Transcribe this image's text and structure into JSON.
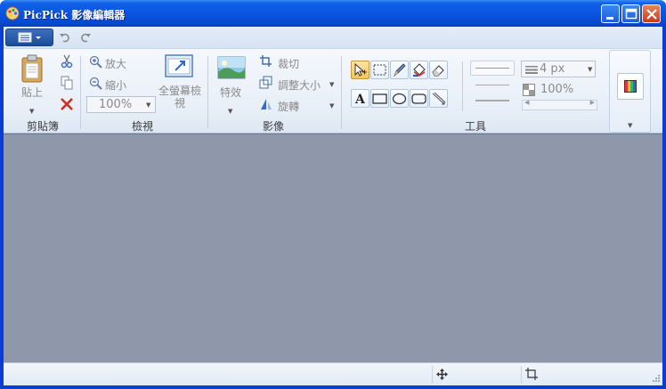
{
  "window": {
    "title": "PicPick 影像編輯器",
    "buttons": [
      "minimize",
      "maximize",
      "close"
    ]
  },
  "quick_access": {
    "items": [
      {
        "name": "app-menu",
        "icon": "menu-icon"
      },
      {
        "name": "undo",
        "icon": "undo-icon"
      },
      {
        "name": "redo",
        "icon": "redo-icon"
      }
    ]
  },
  "ribbon": {
    "clipboard": {
      "label": "剪貼簿",
      "paste": "貼上",
      "cut_icon": "scissors-icon",
      "copy_icon": "copy-icon",
      "delete_icon": "delete-x-icon"
    },
    "view": {
      "label": "檢視",
      "zoom_in": "放大",
      "zoom_out": "縮小",
      "zoom_value": "100%",
      "fullscreen_line1": "全螢幕檢",
      "fullscreen_line2": "視"
    },
    "image": {
      "label": "影像",
      "effects": "特效",
      "crop": "裁切",
      "resize": "調整大小",
      "rotate": "旋轉"
    },
    "tools": {
      "label": "工具",
      "line_width": "4 px",
      "opacity": "100%",
      "tool_icons": [
        "select-arrow-icon",
        "marquee-select-icon",
        "pen-icon",
        "fill-bucket-icon",
        "eraser-icon",
        "text-icon",
        "rectangle-icon",
        "ellipse-icon",
        "rounded-rectangle-icon",
        "line-arrows-icon"
      ]
    },
    "color_icon": "color-palette-icon"
  },
  "status": {
    "move_icon": "move-cross-icon",
    "size_icon": "resize-box-icon",
    "grip_icon": "size-grip-icon"
  },
  "colors": {
    "title_blue": "#0a55e0",
    "ribbon_bg": "#e8eff8",
    "canvas_bg": "#8f98aa",
    "active_tool": "#f6c35e"
  }
}
